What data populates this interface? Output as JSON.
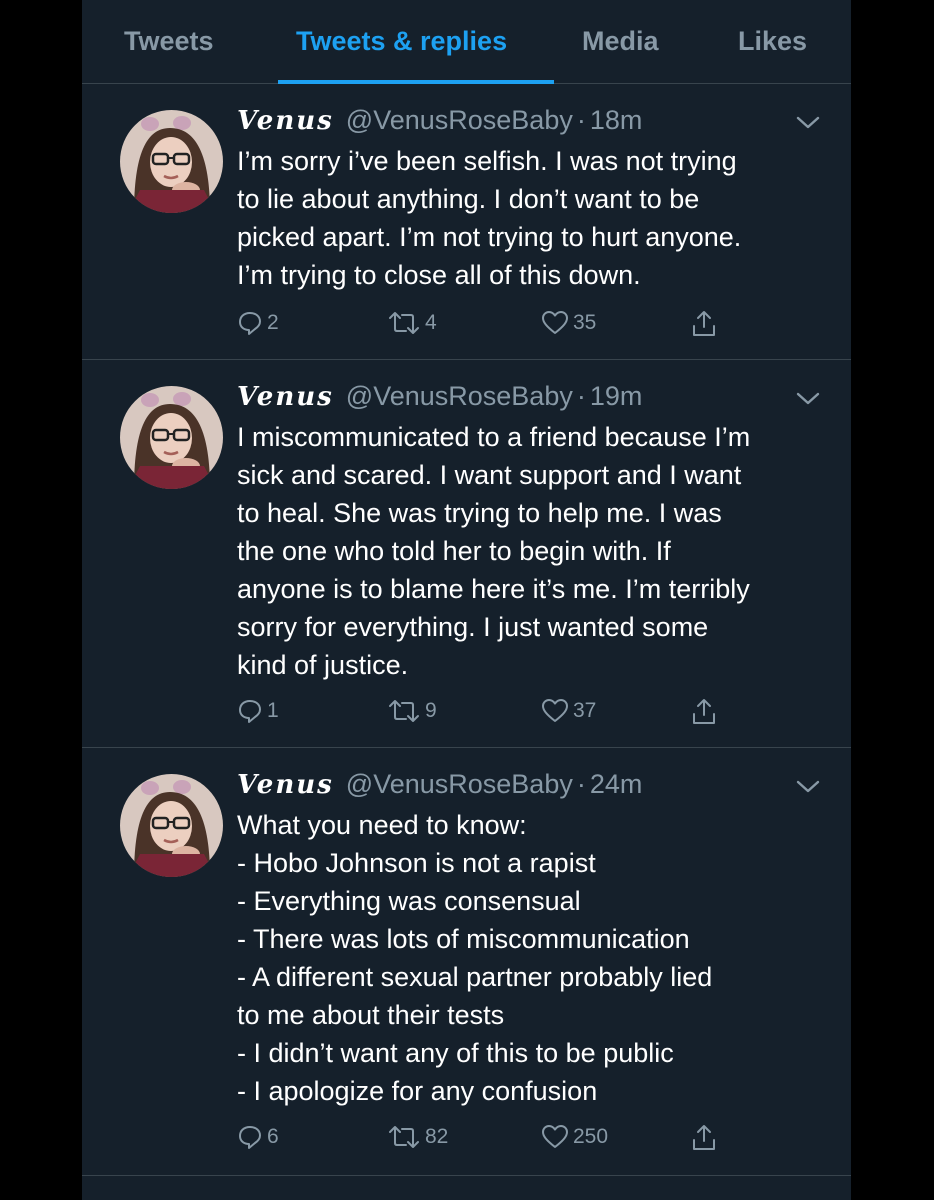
{
  "tabs": [
    {
      "label": "Tweets"
    },
    {
      "label": "Tweets & replies",
      "active": true
    },
    {
      "label": "Media"
    },
    {
      "label": "Likes"
    }
  ],
  "colors": {
    "background": "#15202b",
    "accent": "#1da1f2",
    "muted": "#8899a6",
    "divider": "#38444d"
  },
  "tweets": [
    {
      "name": "Venus",
      "handle": "@VenusRoseBaby",
      "time": "18m",
      "text": "I’m sorry i’ve been selfish. I was not trying\nto lie about anything. I don’t want to be\npicked apart. I’m not trying to hurt anyone.\nI’m trying to close all of this down.",
      "replies": "2",
      "retweets": "4",
      "likes": "35"
    },
    {
      "name": "Venus",
      "handle": "@VenusRoseBaby",
      "time": "19m",
      "text": "I miscommunicated to a friend because I’m\nsick and scared. I want support and I want\nto heal. She was trying to help me. I was\nthe one who told her to begin with. If\nanyone is to blame here it’s me. I’m terribly\nsorry for everything. I just wanted some\nkind of justice.",
      "replies": "1",
      "retweets": "9",
      "likes": "37"
    },
    {
      "name": "Venus",
      "handle": "@VenusRoseBaby",
      "time": "24m",
      "text": "What you need to know:\n- Hobo Johnson is not a rapist\n- Everything was consensual\n- There was lots of miscommunication\n- A different sexual partner probably lied\nto me about their tests\n- I didn’t want any of this to be public\n- I apologize for any confusion",
      "replies": "6",
      "retweets": "82",
      "likes": "250"
    }
  ]
}
